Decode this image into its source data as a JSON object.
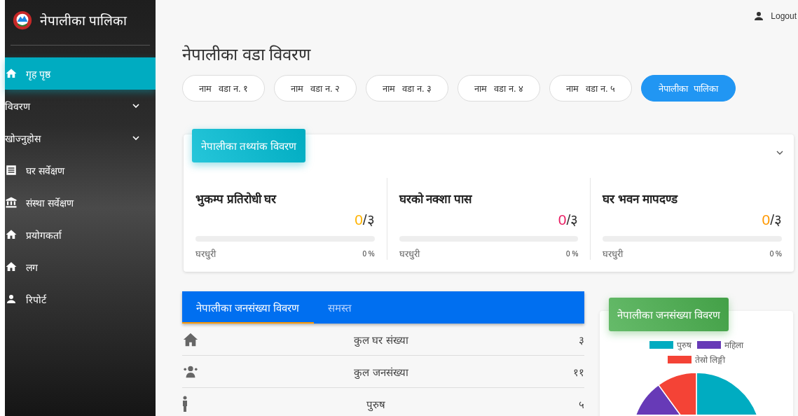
{
  "sidebar": {
    "brand": "नेपालीका पालिका",
    "items": [
      {
        "label": "गृह पृष्ठ",
        "kind": "home",
        "selected": true
      },
      {
        "label": "विवरण",
        "kind": "group",
        "selected": false
      },
      {
        "label": "खोज्नुहोस",
        "kind": "group",
        "selected": false
      },
      {
        "label": "घर सर्वेक्षण",
        "kind": "list",
        "selected": false
      },
      {
        "label": "संस्था सर्वेक्षण",
        "kind": "institution",
        "selected": false
      },
      {
        "label": "प्रयोगकर्ता",
        "kind": "home",
        "selected": false
      },
      {
        "label": "लग",
        "kind": "home",
        "selected": false
      },
      {
        "label": "रिपोर्ट",
        "kind": "user",
        "selected": false
      }
    ]
  },
  "topbar": {
    "logout": "Logout"
  },
  "page_title": "नेपालीका वडा विवरण",
  "ward_buttons": [
    {
      "label": "नाम   वडा न. १",
      "selected": false
    },
    {
      "label": "नाम   वडा न. २",
      "selected": false
    },
    {
      "label": "नाम   वडा न. ३",
      "selected": false
    },
    {
      "label": "नाम   वडा न. ४",
      "selected": false
    },
    {
      "label": "नाम   वडा न. ५",
      "selected": false
    },
    {
      "label": "नेपालीका  पालिका",
      "selected": true
    }
  ],
  "stats_panel": {
    "title": "नेपालीका तथ्यांक विवरण",
    "cards": [
      {
        "title": "भुकम्प प्रतिरोधी घर",
        "value": "0",
        "total": "/३",
        "color": "#ffb300",
        "level": 0,
        "label": "घरधुरी",
        "reading": "0 %"
      },
      {
        "title": "घरको नक्शा पास",
        "value": "0",
        "total": "/३",
        "color": "#e91e63",
        "level": 0,
        "label": "घरधुरी",
        "reading": "0 %"
      },
      {
        "title": "घर भवन मापदण्ड",
        "value": "0",
        "total": "/३",
        "color": "#ff9800",
        "level": 0,
        "label": "घरधुरी",
        "reading": "0 %"
      }
    ]
  },
  "population_tabs": [
    {
      "label": "नेपालीका जनसंख्या विवरण",
      "selected": true
    },
    {
      "label": "समस्त",
      "selected": false
    }
  ],
  "population_rows": [
    {
      "kind": "house",
      "label": "कुल घर संख्या",
      "value": "३"
    },
    {
      "kind": "people",
      "label": "कुल जनसंख्या",
      "value": "११"
    },
    {
      "kind": "man",
      "label": "पुरुष",
      "value": "५"
    }
  ],
  "pie_card": {
    "title": "नेपालीका जनसंख्या विवरण",
    "legend": [
      {
        "label": "पुरुष",
        "color": "#00acc1"
      },
      {
        "label": "महिला",
        "color": "#673ab7"
      },
      {
        "label": "तेस्रो लिङ्गी",
        "color": "#f44336"
      }
    ]
  }
}
